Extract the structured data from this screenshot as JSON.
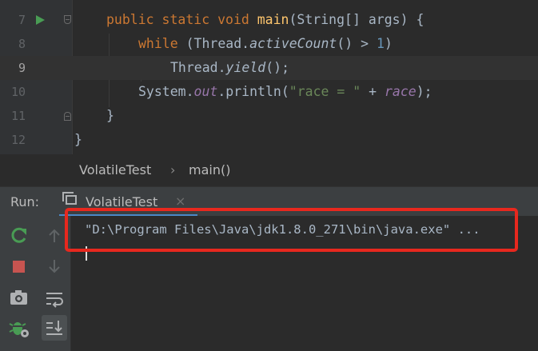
{
  "editor": {
    "lines": [
      {
        "num": "7"
      },
      {
        "num": "8"
      },
      {
        "num": "9"
      },
      {
        "num": "10"
      },
      {
        "num": "11"
      },
      {
        "num": "12"
      }
    ],
    "code": {
      "l7": {
        "kw": "public static void ",
        "fn": "main",
        "rest": "(String[] args) {"
      },
      "l8": {
        "kw": "while",
        "a": " (Thread.",
        "it": "activeCount",
        "b": "() > ",
        "num": "1",
        "c": ")"
      },
      "l9": {
        "a": "Thread.",
        "it": "yield",
        "b": "();"
      },
      "l10": {
        "a": "System.",
        "st": "out",
        "b": ".println(",
        "str": "\"race = \"",
        "c": " + ",
        "st2": "race",
        "d": ");"
      },
      "l11": {
        "a": "}"
      },
      "l12": {
        "a": "}"
      }
    }
  },
  "breadcrumb": {
    "class_name": "VolatileTest",
    "separator": "›",
    "method_name": "main()"
  },
  "run_panel": {
    "label": "Run:",
    "tab_label": "VolatileTest",
    "tab_close": "×",
    "console_output": "\"D:\\Program Files\\Java\\jdk1.8.0_271\\bin\\java.exe\" ..."
  },
  "toolbar": {
    "rerun_icon": "rerun-icon",
    "stop_icon": "stop-icon",
    "camera_icon": "camera-icon",
    "debug_icon": "debug-icon",
    "up_icon": "up-arrow-icon",
    "down_icon": "down-arrow-icon",
    "wrap_icon": "soft-wrap-icon",
    "scroll_icon": "scroll-to-end-icon"
  },
  "colors": {
    "annotation_red": "#e8281e",
    "tab_accent": "#4a88c7",
    "run_green": "#499c54",
    "stop_red": "#c75450"
  }
}
